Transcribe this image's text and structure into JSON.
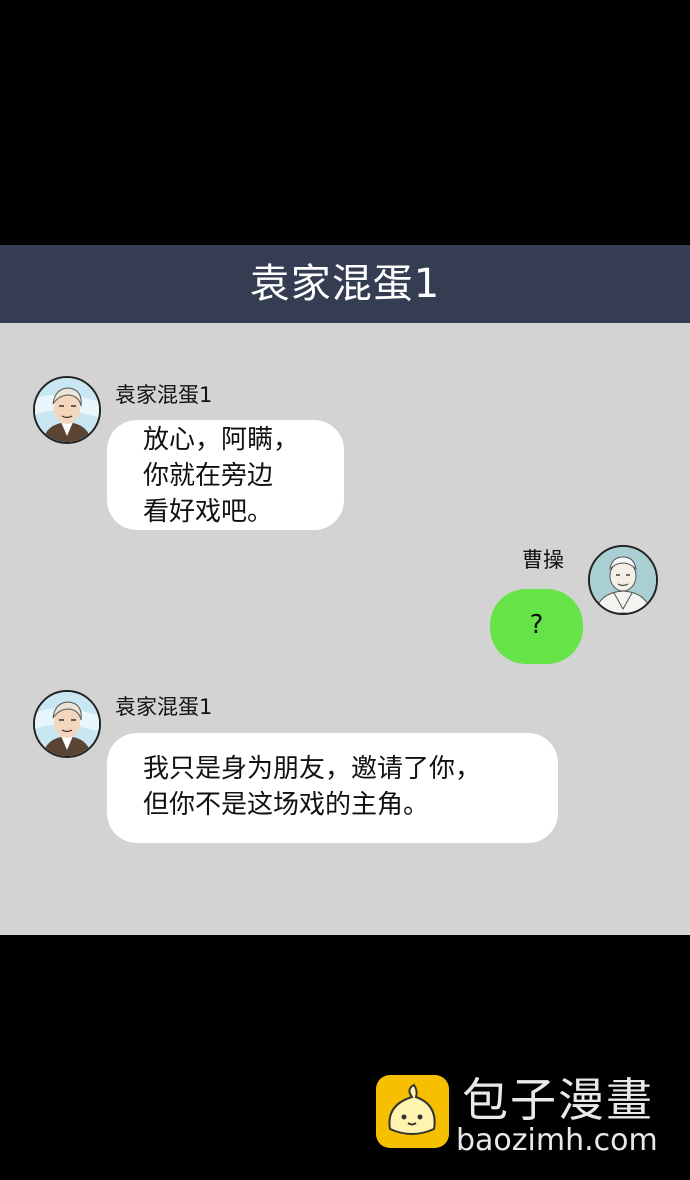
{
  "header": {
    "title": "袁家混蛋1"
  },
  "messages": [
    {
      "side": "left",
      "sender": "袁家混蛋1",
      "avatar_icon": "man-portrait-avatar-icon",
      "lines": [
        "放心，阿瞒，",
        "你就在旁边",
        "看好戏吧。"
      ]
    },
    {
      "side": "right",
      "sender": "曹操",
      "avatar_icon": "old-man-portrait-avatar-icon",
      "lines": [
        "?"
      ]
    },
    {
      "side": "left",
      "sender": "袁家混蛋1",
      "avatar_icon": "man-portrait-avatar-icon",
      "lines": [
        "我只是身为朋友，邀请了你，",
        "但你不是这场戏的主角。"
      ]
    }
  ],
  "watermark": {
    "logo_icon": "steamed-bun-logo-icon",
    "name": "包子漫畫",
    "domain": "baozimh.com"
  },
  "colors": {
    "header_bg": "#343d52",
    "chat_bg": "#d3d3d3",
    "bubble_left": "#ffffff",
    "bubble_right": "#66e347",
    "logo": "#f6c000"
  }
}
